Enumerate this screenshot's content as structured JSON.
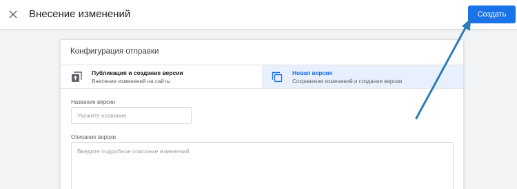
{
  "header": {
    "title": "Внесение изменений",
    "create_label": "Создать"
  },
  "card": {
    "title": "Конфигурация отправки",
    "options": [
      {
        "title": "Публикация и создание версии",
        "subtitle": "Внесение изменений на сайты",
        "icon": "publish-icon",
        "selected": false
      },
      {
        "title": "Новая версия",
        "subtitle": "Сохранение изменений и создание версии",
        "icon": "new-version-icon",
        "selected": true
      }
    ],
    "version_name": {
      "label": "Название версии",
      "placeholder": "Укажите название",
      "value": ""
    },
    "version_description": {
      "label": "Описание версии",
      "placeholder": "Введите подробное описание изменений",
      "value": ""
    }
  },
  "colors": {
    "accent": "#1a73e8",
    "selected_bg": "#e8f0fe",
    "annotation_arrow": "#2a7db3"
  },
  "icons": [
    "close-icon",
    "publish-icon",
    "new-version-icon"
  ]
}
